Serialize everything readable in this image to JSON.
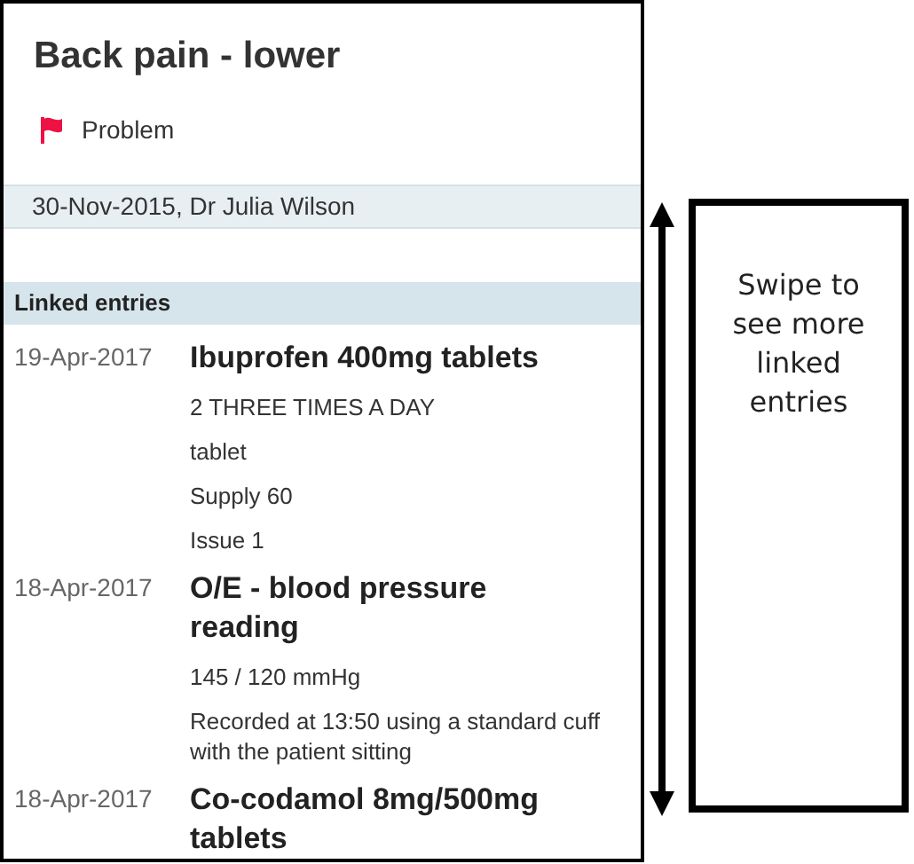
{
  "record": {
    "title": "Back pain - lower",
    "type": "Problem",
    "consultation": "30-Nov-2015, Dr Julia Wilson"
  },
  "linked_entries": {
    "heading": "Linked entries",
    "entries": [
      {
        "date": "19-Apr-2017",
        "title": "Ibuprofen 400mg tablets",
        "details": [
          "2 THREE TIMES A DAY",
          "tablet",
          "Supply 60",
          "Issue 1"
        ]
      },
      {
        "date": "18-Apr-2017",
        "title": "O/E - blood pressure reading",
        "details": [
          "145 / 120 mmHg",
          "Recorded at 13:50 using a standard cuff with the patient sitting"
        ]
      },
      {
        "date": "18-Apr-2017",
        "title": "Co-codamol 8mg/500mg tablets"
      }
    ]
  },
  "callout": {
    "text": "Swipe to see more linked entries"
  }
}
